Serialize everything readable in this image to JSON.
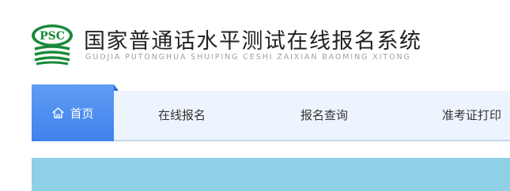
{
  "header": {
    "logo_text": "PSC",
    "title": "国家普通话水平测试在线报名系统",
    "subtitle": "GUOJIA PUTONGHUA SHUIPING CESHI ZAIXIAN BAOMING XITONG"
  },
  "nav": {
    "home": {
      "label": "首页",
      "icon": "home-icon"
    },
    "items": [
      {
        "label": "在线报名"
      },
      {
        "label": "报名查询"
      },
      {
        "label": "准考证打印"
      }
    ]
  },
  "colors": {
    "logo_green": "#1a8a3a",
    "nav_active": "#4a8cf0",
    "nav_bg": "#eef4fd",
    "banner": "#8fd0e6"
  }
}
